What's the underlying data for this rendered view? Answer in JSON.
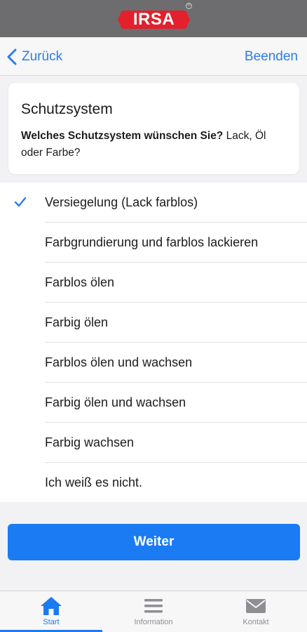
{
  "brand": {
    "logo_text": "IRSA",
    "logo_color": "#e3202c",
    "reg_mark": "®"
  },
  "nav": {
    "back_label": "Zurück",
    "end_label": "Beenden",
    "accent_color": "#2a7cf3"
  },
  "question": {
    "title": "Schutzsystem",
    "prompt_bold": "Welches Schutzsystem wünschen Sie?",
    "prompt_rest": " Lack, Öl oder Farbe?"
  },
  "options": [
    {
      "label": "Versiegelung (Lack farblos)",
      "selected": true
    },
    {
      "label": "Farbgrundierung und farblos lackieren",
      "selected": false
    },
    {
      "label": "Farblos ölen",
      "selected": false
    },
    {
      "label": "Farbig ölen",
      "selected": false
    },
    {
      "label": "Farblos ölen und wachsen",
      "selected": false
    },
    {
      "label": "Farbig ölen und wachsen",
      "selected": false
    },
    {
      "label": "Farbig wachsen",
      "selected": false
    },
    {
      "label": "Ich weiß es nicht.",
      "selected": false
    }
  ],
  "primary_button": {
    "label": "Weiter",
    "color": "#1a7bf2"
  },
  "tabs": [
    {
      "label": "Start",
      "icon": "home-icon",
      "active": true
    },
    {
      "label": "Information",
      "icon": "menu-icon",
      "active": false
    },
    {
      "label": "Kontakt",
      "icon": "mail-icon",
      "active": false
    }
  ]
}
